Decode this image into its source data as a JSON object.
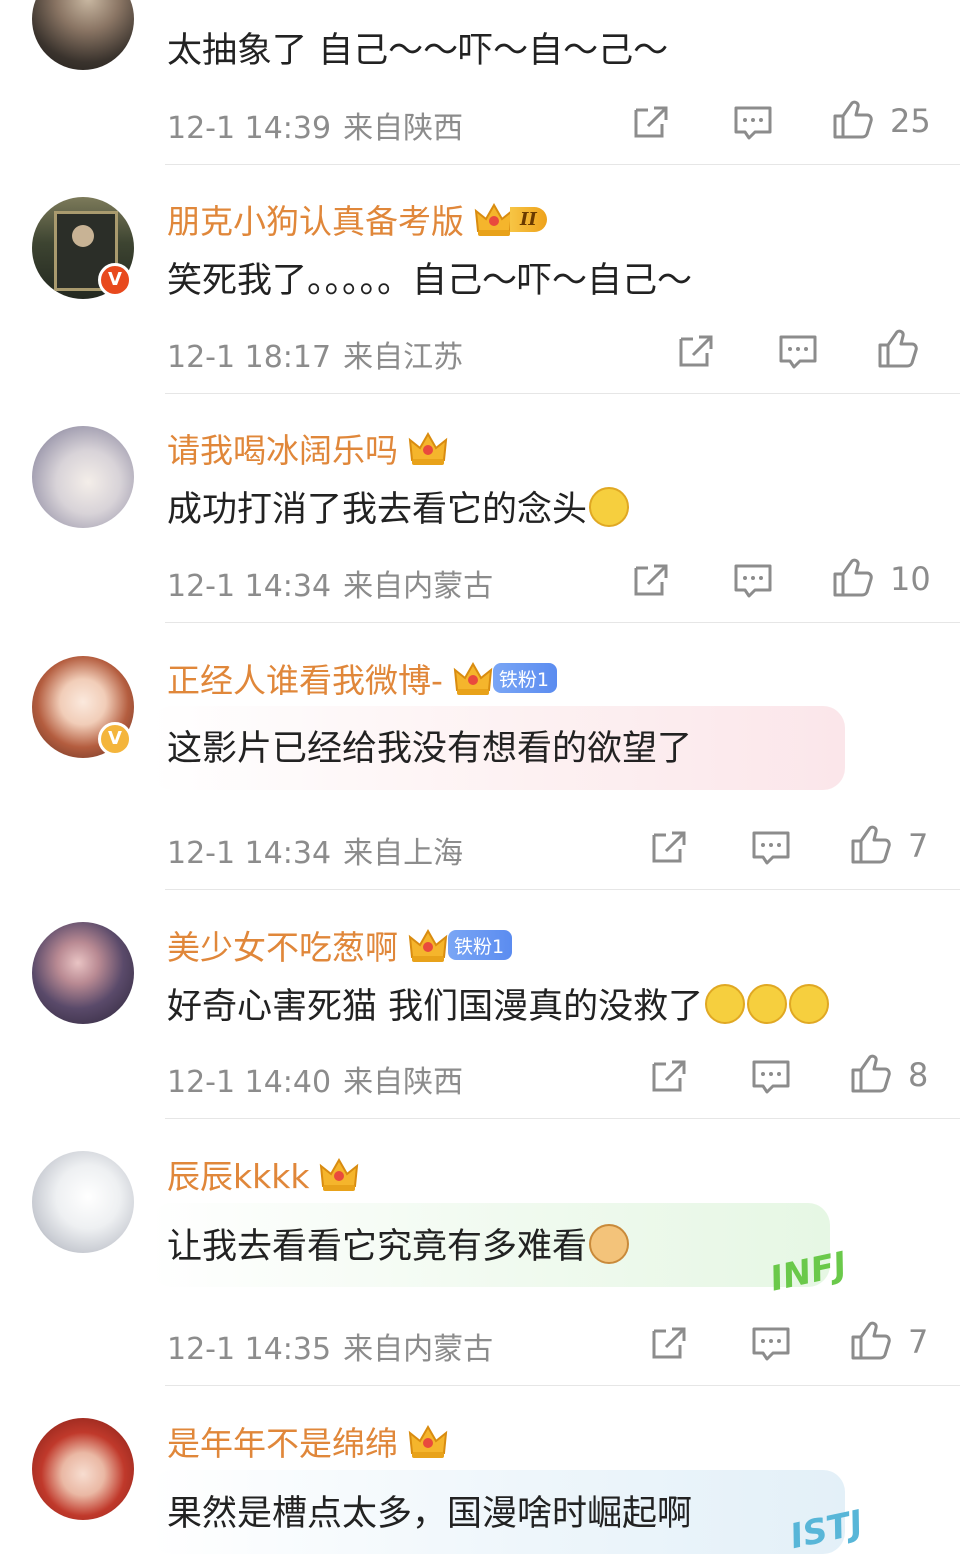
{
  "colors": {
    "username": "#e0873a",
    "meta": "#8c8c8c",
    "text": "#222222",
    "divider": "#e6e6e6"
  },
  "actions": {
    "share_icon": "share-icon",
    "reply_icon": "comment-icon",
    "like_icon": "thumbs-up-icon"
  },
  "comments": [
    {
      "name": "",
      "text": "太抽象了 自己～～吓～自～己～",
      "time": "12-1 14:39",
      "location": "来自陕西",
      "likes": "25"
    },
    {
      "name": "朋克小狗认真备考版",
      "badge": "II",
      "text": "笑死我了。。。。。自己～吓～自己～",
      "time": "12-1 18:17",
      "location": "来自江苏",
      "likes": ""
    },
    {
      "name": "请我喝冰阔乐吗",
      "badge": "4",
      "text": "成功打消了我去看它的念头",
      "time": "12-1 14:34",
      "location": "来自内蒙古",
      "likes": "10"
    },
    {
      "name": "正经人谁看我微博-",
      "badge": "3",
      "fan": "铁粉1",
      "text": "这影片已经给我没有想看的欲望了",
      "time": "12-1 14:34",
      "location": "来自上海",
      "likes": "7"
    },
    {
      "name": "美少女不吃葱啊",
      "badge": "2",
      "fan": "铁粉1",
      "text": "好奇心害死猫 我们国漫真的没救了",
      "time": "12-1 14:40",
      "location": "来自陕西",
      "likes": "8"
    },
    {
      "name": "辰辰kkkk",
      "badge": "4",
      "text": "让我去看看它究竟有多难看",
      "time": "12-1 14:35",
      "location": "来自内蒙古",
      "likes": "7",
      "sticker": "INFJ"
    },
    {
      "name": "是年年不是绵绵",
      "badge": "4",
      "text": "果然是槽点太多，国漫啥时崛起啊",
      "sticker": "ISTJ"
    }
  ]
}
